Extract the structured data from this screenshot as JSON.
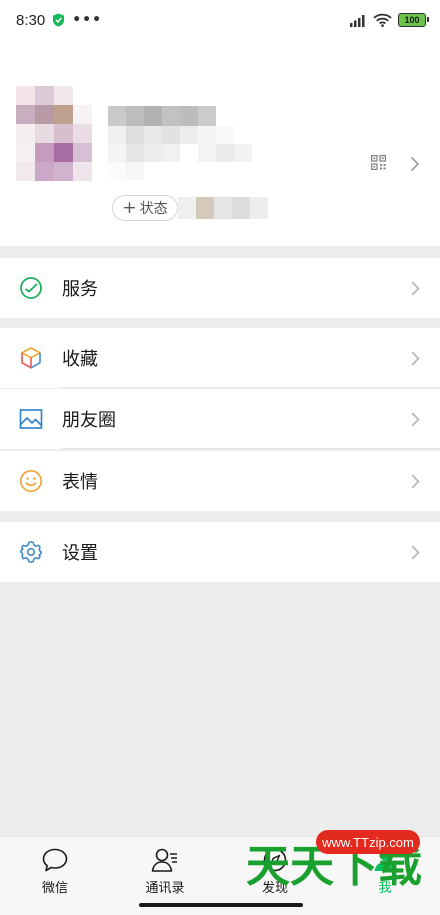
{
  "status_bar": {
    "time": "8:30",
    "battery": "100"
  },
  "profile": {
    "status_button": "状态"
  },
  "menu": {
    "service": "服务",
    "favorites": "收藏",
    "moments": "朋友圈",
    "stickers": "表情",
    "settings": "设置"
  },
  "bottom_nav": {
    "chats": "微信",
    "contacts": "通讯录",
    "discover": "发现",
    "me": "我"
  },
  "watermark": {
    "url": "www.TTzip.com",
    "text": "天天下载"
  },
  "colors": {
    "accent_green": "#07c160",
    "chevron_gray": "#b2b2b2",
    "background": "#ededed"
  }
}
